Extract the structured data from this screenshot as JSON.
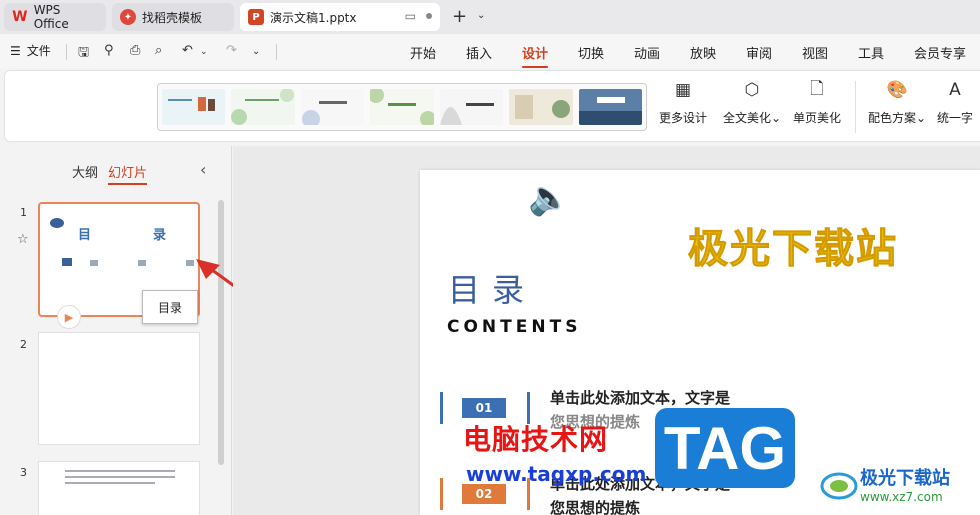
{
  "tabs": {
    "wps": "WPS Office",
    "template": "找稻壳模板",
    "doc": "演示文稿1.pptx"
  },
  "menubar": {
    "file": "文件",
    "tabs": [
      "开始",
      "插入",
      "设计",
      "切换",
      "动画",
      "放映",
      "审阅",
      "视图",
      "工具",
      "会员专享"
    ],
    "active": "设计"
  },
  "ribbon": {
    "buttons": [
      "更多设计",
      "全文美化",
      "单页美化",
      "配色方案",
      "统一字"
    ]
  },
  "panel": {
    "outline_tab": "大纲",
    "slides_tab": "幻灯片",
    "slide_numbers": [
      "1",
      "2",
      "3"
    ],
    "thumb1_title_a": "目",
    "thumb1_title_b": "录",
    "tooltip": "目录"
  },
  "slide": {
    "watermark_title": "极光下载站",
    "heading": "目录",
    "subheading": "CONTENTS",
    "items": [
      {
        "num": "01",
        "line1": "单击此处添加文本，文字是",
        "line2": "您思想的提炼",
        "color": "#3d6fb4"
      },
      {
        "num": "02",
        "line1": "单击此处添加文本，文字是",
        "line2": "您思想的提炼",
        "color": "#e07a3a"
      }
    ]
  },
  "overlay": {
    "red_text": "电脑技术网",
    "url": "www.tagxp.com",
    "tag": "TAG",
    "brand_name": "极光下载站",
    "brand_url": "www.xz7.com"
  },
  "colors": {
    "accent": "#d0411f",
    "selection": "#e8855a",
    "heading_blue": "#3a5f9b"
  }
}
